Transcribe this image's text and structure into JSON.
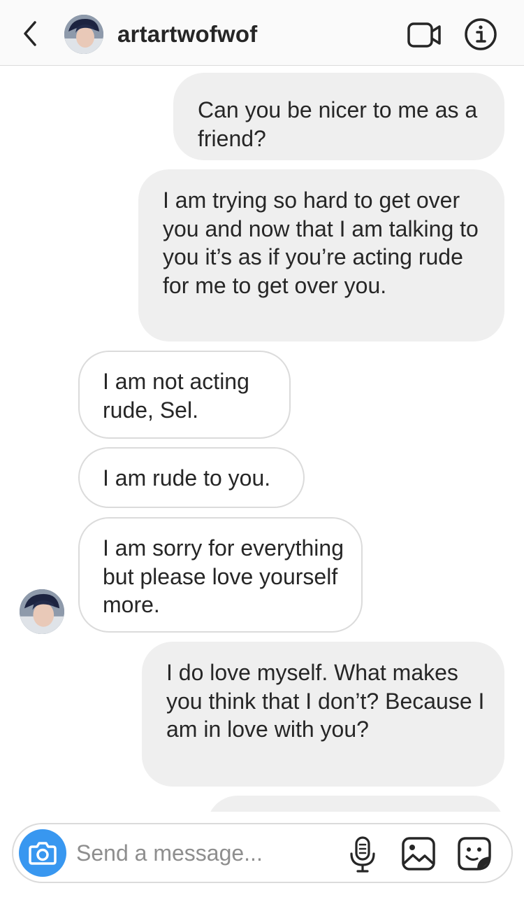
{
  "header": {
    "username": "artartwofwof"
  },
  "messages": [
    {
      "direction": "out",
      "text": "Can you be nicer to me as a friend?"
    },
    {
      "direction": "out",
      "text": "I am trying so hard to get over you and now that I am talking to you it’s as if you’re acting rude for me to get over you."
    },
    {
      "direction": "in",
      "text": "I am not acting rude, Sel."
    },
    {
      "direction": "in",
      "text": "I am rude to you."
    },
    {
      "direction": "in",
      "text": "I am sorry for everything but please love yourself more."
    },
    {
      "direction": "out",
      "text": "I do love myself. What makes you think that I don’t? Because I am in love with you?"
    },
    {
      "direction": "out",
      "text": ""
    }
  ],
  "composer": {
    "placeholder": "Send a message..."
  },
  "icons": {
    "back": "chevron-left-icon",
    "video": "video-camera-icon",
    "info": "info-icon",
    "camera": "camera-icon",
    "mic": "microphone-icon",
    "gallery": "image-icon",
    "sticker": "sticker-icon"
  },
  "colors": {
    "outgoing_bubble": "#efefef",
    "incoming_border": "#dbdbdb",
    "camera_button": "#3897f0",
    "text": "#262626",
    "placeholder": "#8e8e8e"
  }
}
